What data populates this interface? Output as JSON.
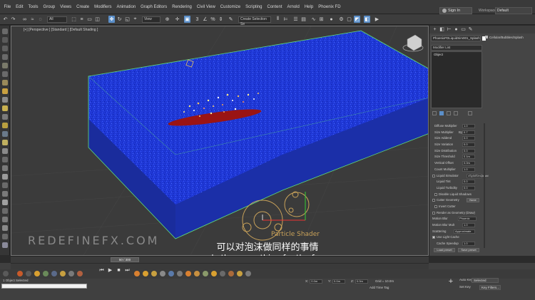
{
  "menu": [
    "File",
    "Edit",
    "Tools",
    "Group",
    "Views",
    "Create",
    "Modifiers",
    "Animation",
    "Graph Editors",
    "Rendering",
    "Civil View",
    "Customize",
    "Scripting",
    "Content",
    "Arnold",
    "Help",
    "Phoenix FD"
  ],
  "account": {
    "signin_label": "Sign In",
    "workspace_label": "Workspaces:",
    "workspace_value": "Default"
  },
  "toolbar": {
    "layer_dd": "All",
    "coord_dd": "View",
    "selset_dd": "Create Selection Se"
  },
  "viewport": {
    "label": "[+] [Perspective ] [Standard ] [Default Shading ]",
    "particle_label": "Particle Shader",
    "watermark": "REDEFINEFX.COM"
  },
  "subtitles": {
    "cn": "可以对泡沫做同样的事情",
    "en": "can do the same thing for the foam so"
  },
  "command_panel": {
    "object_name": "PhoenixFDLiquidSim001_Splash",
    "category": "Cellular/Bubbles/Splash",
    "modifier_list": "Modifier List",
    "stack_item": "Object",
    "params": [
      {
        "label": "Diffuse Multiplier",
        "value": "1.0"
      },
      {
        "label": "Size Multiplier",
        "value": "0.7",
        "prefix": "By"
      },
      {
        "label": "Size Addend",
        "value": "0.0"
      },
      {
        "label": "Size Variation",
        "value": "0.0"
      },
      {
        "label": "Size Distribution",
        "value": "0.0"
      },
      {
        "label": "Size Threshold",
        "value": "0.1m"
      },
      {
        "label": "Vertical Offset",
        "value": "0.0m"
      },
      {
        "label": "Count Multiplier",
        "value": "1.0"
      }
    ],
    "liquid_sim_label": "Liquid Simulator",
    "liquid_sim_value": "xSplidSimLiquid",
    "liquid_tint_label": "Liquid Tint",
    "liquid_tint_value": "0.0",
    "liquid_turb_label": "Liquid Turbidity",
    "liquid_turb_value": "0.0",
    "disable_shadows": "Disable Liquid Shadows",
    "cutter_geometry": "Cutter Geometry",
    "cutter_value": "None",
    "invert_cutter": "Invert Cutter",
    "render_as_geometry": "Render as Geometry (Draw)",
    "motion_blur_label": "Motion Blur",
    "motion_blur_value": "Phoenix",
    "motion_blur_mult_label": "Motion Blur Mult",
    "motion_blur_mult_value": "1.0",
    "scattering_label": "Scattering",
    "scattering_value": "Approximate",
    "light_cache": "Use Light Cache",
    "cache_speedup_label": "Cache Speedup",
    "cache_speedup_value": "1.0",
    "load_preset": "Load preset",
    "save_preset": "Save preset"
  },
  "timeline": {
    "frame": "50 / 300"
  },
  "status": {
    "selection": "1 Object Selected",
    "x_label": "X:",
    "x_value": "0.0m",
    "y_label": "Y:",
    "y_value": "0.0m",
    "z_label": "Z:",
    "z_value": "0.0m",
    "grid": "Grid = 10.0m",
    "add_time_tag": "Add Time Tag",
    "auto_key": "Auto Key",
    "selected": "Selected",
    "set_key": "Set Key",
    "key_filters": "Key Filters..."
  }
}
